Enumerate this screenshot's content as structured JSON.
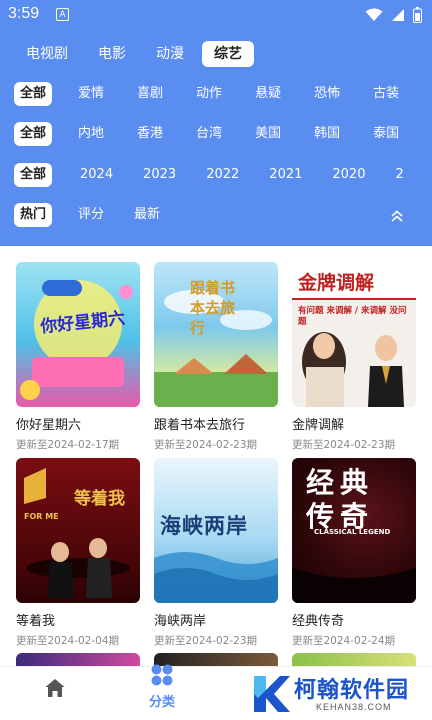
{
  "status_bar": {
    "time": "3:59",
    "a_badge": "A",
    "icons": [
      "wifi-icon",
      "signal-icon",
      "battery-icon"
    ]
  },
  "colors": {
    "header_bg": "#5a8df0",
    "accent": "#5a8df0",
    "brand": "#1c55c9"
  },
  "tabs": [
    {
      "label": "电视剧",
      "active": false
    },
    {
      "label": "电影",
      "active": false
    },
    {
      "label": "动漫",
      "active": false
    },
    {
      "label": "综艺",
      "active": true
    }
  ],
  "filters": {
    "genre": [
      "全部",
      "爱情",
      "喜剧",
      "动作",
      "悬疑",
      "恐怖",
      "古装"
    ],
    "region": [
      "全部",
      "内地",
      "香港",
      "台湾",
      "美国",
      "韩国",
      "泰国"
    ],
    "year": [
      "全部",
      "2024",
      "2023",
      "2022",
      "2021",
      "2020",
      "2"
    ],
    "sort": [
      "热门",
      "评分",
      "最新"
    ]
  },
  "cards": [
    {
      "title": "你好星期六",
      "update": "更新至2024-02-17期",
      "poster_text": "你好星期六"
    },
    {
      "title": "跟着书本去旅行",
      "update": "更新至2024-02-23期",
      "poster_text": "跟着书本去旅行"
    },
    {
      "title": "金牌调解",
      "update": "更新至2024-02-23期",
      "poster_text": "金牌调解",
      "poster_sub": "有问题 来调解 / 来调解 没问题"
    },
    {
      "title": "等着我",
      "update": "更新至2024-02-04期",
      "poster_text": "等着我",
      "poster_sub": "FOR ME"
    },
    {
      "title": "海峡两岸",
      "update": "更新至2024-02-23期",
      "poster_text": "海峡两岸"
    },
    {
      "title": "经典传奇",
      "update": "更新至2024-02-24期",
      "poster_text": "经典传奇",
      "poster_sub": "CLASSICAL LEGEND"
    }
  ],
  "bottom_nav": [
    {
      "label": "",
      "icon": "home-icon",
      "active": false
    },
    {
      "label": "分类",
      "icon": "category-icon",
      "active": true
    }
  ],
  "watermark": {
    "title": "柯翰软件园",
    "sub": "KEHAN38.COM"
  }
}
